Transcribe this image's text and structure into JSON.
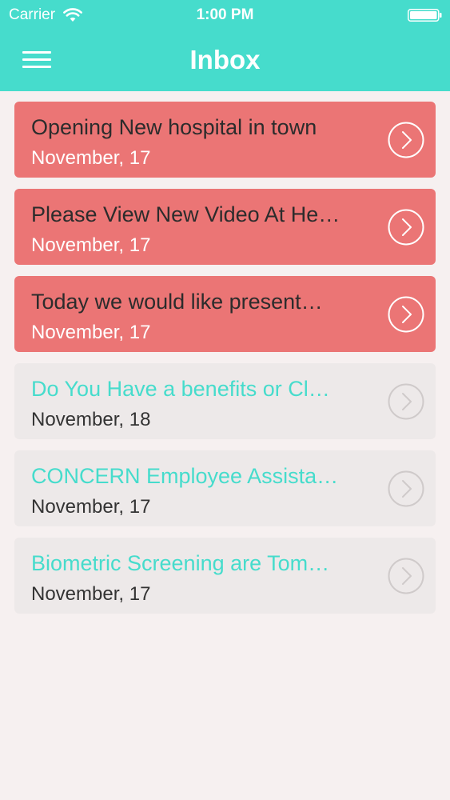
{
  "status_bar": {
    "carrier": "Carrier",
    "time": "1:00 PM"
  },
  "header": {
    "title": "Inbox"
  },
  "colors": {
    "accent": "#46dccc",
    "unread_bg": "#eb7575",
    "read_bg": "#ede9e9",
    "page_bg": "#f6f0f0"
  },
  "messages": [
    {
      "subject": "Opening New hospital in town",
      "date": "November, 17",
      "read": false
    },
    {
      "subject": "Please View New Video At He…",
      "date": "November, 17",
      "read": false
    },
    {
      "subject": "Today we would like present…",
      "date": "November, 17",
      "read": false
    },
    {
      "subject": "Do You Have a benefits or Cl…",
      "date": "November, 18",
      "read": true
    },
    {
      "subject": "CONCERN Employee Assista…",
      "date": "November, 17",
      "read": true
    },
    {
      "subject": "Biometric Screening are Tom…",
      "date": "November, 17",
      "read": true
    }
  ]
}
